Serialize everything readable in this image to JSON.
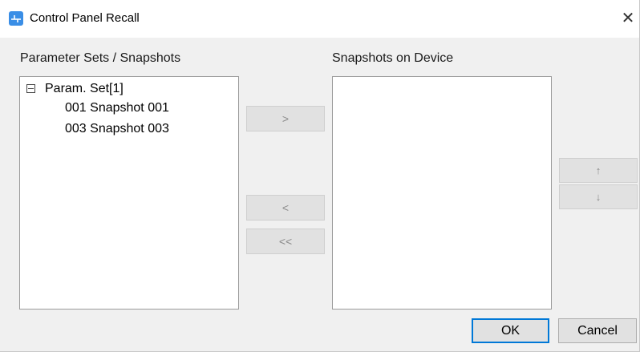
{
  "window": {
    "title": "Control Panel Recall",
    "app_icon": "app-logo-icon",
    "close_glyph": "✕"
  },
  "left_panel": {
    "label": "Parameter Sets / Snapshots",
    "tree": {
      "expander_state": "expanded",
      "root_label": "Param. Set[1]",
      "children": [
        {
          "label": "001 Snapshot 001"
        },
        {
          "label": "003 Snapshot 003"
        }
      ]
    }
  },
  "right_panel": {
    "label": "Snapshots on Device",
    "items": []
  },
  "transfer_buttons": {
    "add_label": ">",
    "remove_label": "<",
    "remove_all_label": "<<"
  },
  "order_buttons": {
    "up_label": "↑",
    "down_label": "↓"
  },
  "footer": {
    "ok_label": "OK",
    "cancel_label": "Cancel"
  },
  "colors": {
    "accent": "#0078d7",
    "icon_blue": "#3a8ee6",
    "dialog_bg": "#f0f0f0",
    "disabled_text": "#8a8a8a"
  }
}
